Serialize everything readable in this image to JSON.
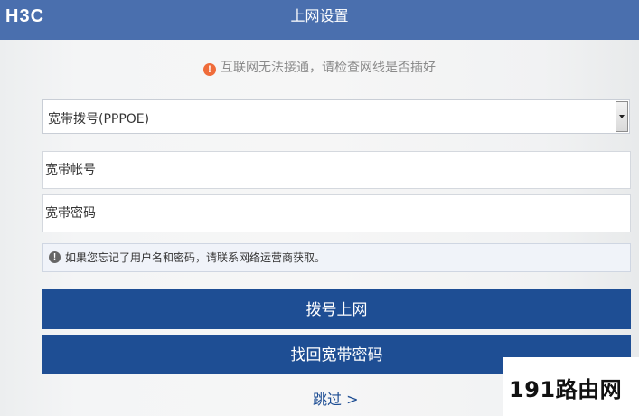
{
  "header": {
    "logo": "H3C",
    "title": "上网设置"
  },
  "alert": {
    "icon": "warning-icon",
    "icon_glyph": "!",
    "text": "互联网无法接通，请检查网线是否插好"
  },
  "connection_type": {
    "selected": "宽带拨号(PPPOE)"
  },
  "account": {
    "placeholder": "宽带帐号"
  },
  "password": {
    "placeholder": "宽带密码"
  },
  "hint": {
    "icon": "info-icon",
    "icon_glyph": "!",
    "text": "如果您忘记了用户名和密码，请联系网络运营商获取。"
  },
  "buttons": {
    "dial": "拨号上网",
    "recover": "找回宽带密码"
  },
  "skip": {
    "label": "跳过 >"
  },
  "watermark": {
    "text": "191路由网"
  },
  "colors": {
    "header_bg": "#4a6fae",
    "button_bg": "#1e4e94",
    "alert_icon": "#ef6c3a",
    "hint_bg": "#f0f3f9"
  }
}
